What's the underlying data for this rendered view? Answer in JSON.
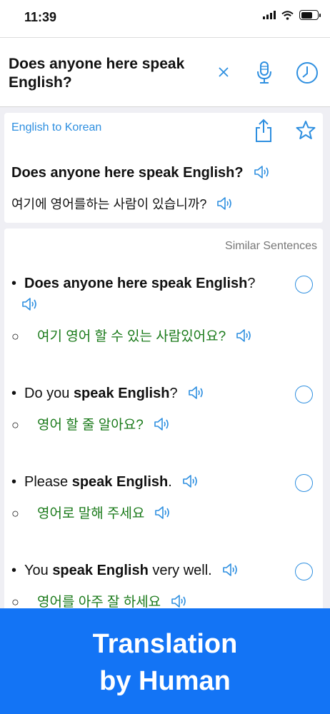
{
  "status": {
    "time": "11:39"
  },
  "search": {
    "query": "Does anyone here speak English?"
  },
  "translation": {
    "language_pair": "English to Korean",
    "source": "Does anyone here speak English?",
    "target": "여기에 영어를하는 사람이 있습니까?"
  },
  "similar": {
    "label": "Similar Sentences",
    "items": [
      {
        "en_html": "<b>Does anyone here speak English</b>?",
        "ko": "여기 영어 할 수 있는 사람있어요?"
      },
      {
        "en_html": "Do you <b>speak English</b>?",
        "ko": "영어 할 줄 알아요?"
      },
      {
        "en_html": "Please <b>speak English</b>.",
        "ko": "영어로 말해 주세요"
      },
      {
        "en_html": "You <b>speak English</b> very well.",
        "ko": "영어를 아주 잘 하세요"
      }
    ]
  },
  "banner": {
    "line1": "Translation",
    "line2": "by Human"
  },
  "icons": {
    "clear": "close-icon",
    "mic": "microphone-icon",
    "history": "clock-icon",
    "share": "share-icon",
    "favorite": "star-icon",
    "speaker": "speaker-icon",
    "select": "radio-icon"
  },
  "colors": {
    "accent": "#2e8fe0",
    "korean_text": "#1a7a1a",
    "banner": "#1374f5"
  }
}
